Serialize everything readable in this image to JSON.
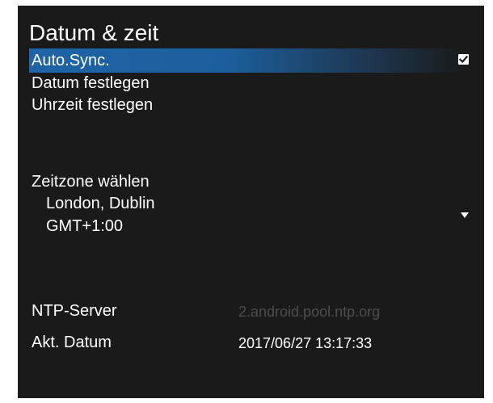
{
  "header": {
    "title": "Datum & zeit"
  },
  "menu": {
    "auto_sync": {
      "label": "Auto.Sync.",
      "checked": true,
      "icon": "checkbox-checked-icon"
    },
    "set_date": {
      "label": "Datum festlegen"
    },
    "set_time": {
      "label": "Uhrzeit festlegen"
    }
  },
  "timezone": {
    "label": "Zeitzone wählen",
    "city": "London, Dublin",
    "offset": "GMT+1:00",
    "icon": "dropdown-arrow-icon"
  },
  "info": {
    "ntp_label": "NTP-Server",
    "ntp_value": "2.android.pool.ntp.org",
    "date_label": "Akt. Datum",
    "date_value": "2017/06/27 13:17:33"
  },
  "colors": {
    "background": "#1b1a1a",
    "highlight": "#1f64a6",
    "text": "#ffffff",
    "disabled_text": "#4d4d4d"
  }
}
